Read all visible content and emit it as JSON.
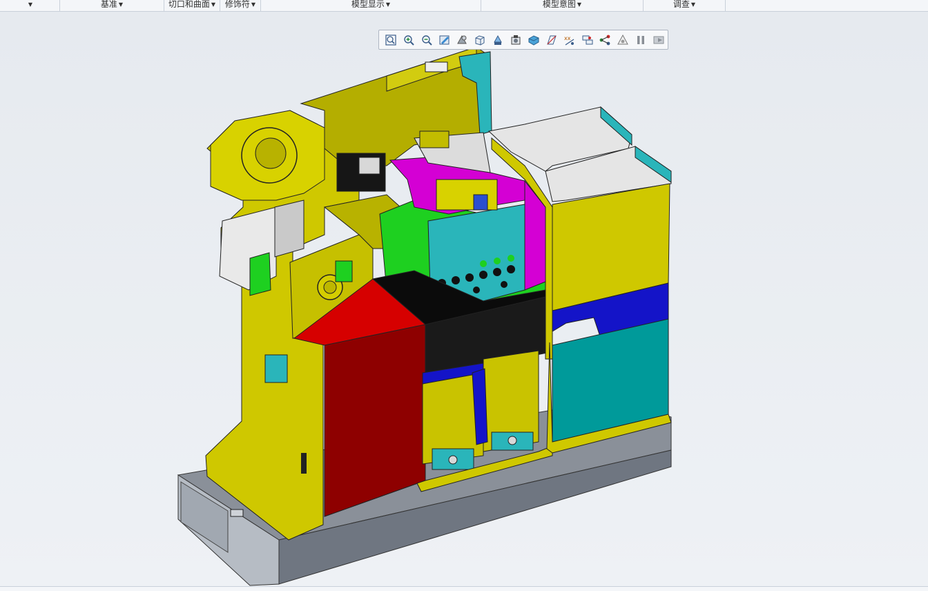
{
  "ribbon": {
    "groups": [
      {
        "label": "",
        "has_arrow": true
      },
      {
        "label": "基准",
        "has_arrow": true
      },
      {
        "label": "切口和曲面",
        "has_arrow": true
      },
      {
        "label": "修饰符",
        "has_arrow": true
      },
      {
        "label": "模型显示",
        "has_arrow": true
      },
      {
        "label": "模型意图",
        "has_arrow": true
      },
      {
        "label": "调查",
        "has_arrow": true
      }
    ]
  },
  "graphics_toolbar": {
    "buttons": [
      {
        "name": "refit-icon"
      },
      {
        "name": "zoom-in-icon"
      },
      {
        "name": "zoom-out-icon"
      },
      {
        "name": "repaint-icon"
      },
      {
        "name": "display-style-icon"
      },
      {
        "name": "saved-orientations-icon"
      },
      {
        "name": "view-manager-icon"
      },
      {
        "name": "perspective-icon"
      },
      {
        "name": "section-icon"
      },
      {
        "name": "datum-display-icon"
      },
      {
        "name": "annotation-display-icon"
      },
      {
        "name": "spin-center-icon"
      },
      {
        "name": "node-filter-icon"
      },
      {
        "name": "appearance-icon"
      },
      {
        "name": "pause-icon"
      },
      {
        "name": "cancel-regen-icon"
      }
    ]
  },
  "colors": {
    "yellow": "#cfc800",
    "olive": "#a9a400",
    "red": "#d60000",
    "teal": "#2ab5ba",
    "magenta": "#d400d4",
    "green": "#1ed020",
    "blue": "#1414c8",
    "grey_base": "#7d848e",
    "black": "#0b0b0b"
  }
}
